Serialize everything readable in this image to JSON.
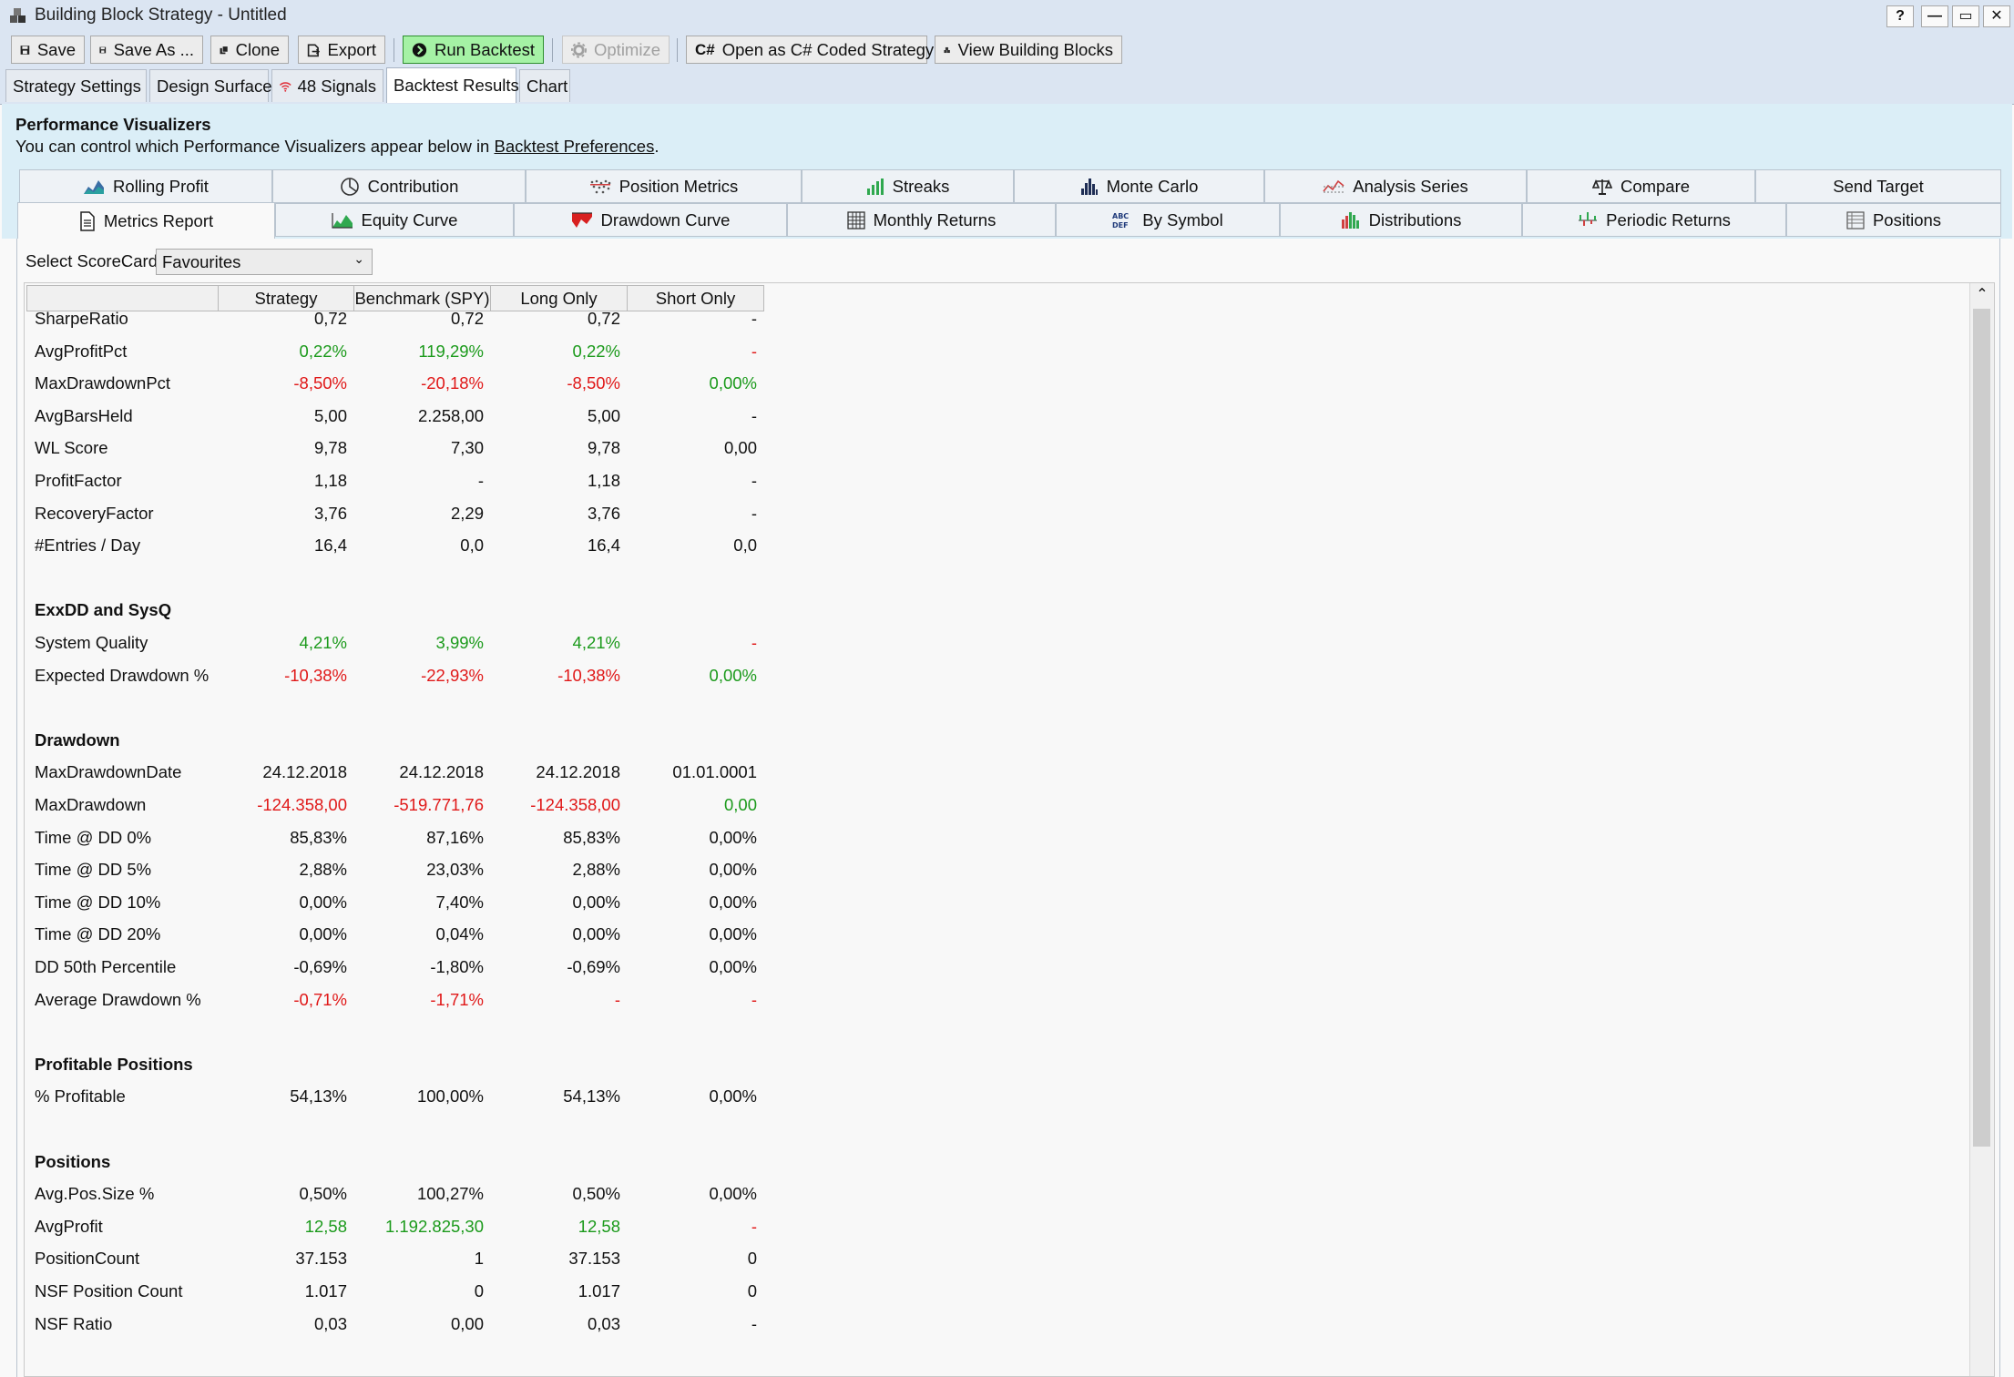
{
  "window": {
    "title": "Building Block Strategy - Untitled",
    "buttons": [
      "?",
      "—",
      "▭",
      "✕"
    ]
  },
  "toolbar": {
    "save": "Save",
    "save_as": "Save As ...",
    "clone": "Clone",
    "export": "Export",
    "run_backtest": "Run Backtest",
    "optimize": "Optimize",
    "open_csharp": "Open as C# Coded Strategy",
    "view_blocks": "View Building Blocks",
    "csharp_glyph": "C#"
  },
  "main_tabs": {
    "strategy_settings": "Strategy Settings",
    "design_surface": "Design Surface",
    "signals": "48 Signals",
    "backtest_results": "Backtest Results",
    "chart": "Chart"
  },
  "info": {
    "heading": "Performance Visualizers",
    "text_before": "You can control which Performance Visualizers appear below in ",
    "link": "Backtest Preferences",
    "text_after": "."
  },
  "visualizer_tabs": {
    "row1": [
      "Rolling Profit",
      "Contribution",
      "Position Metrics",
      "Streaks",
      "Monte Carlo",
      "Analysis Series",
      "Compare",
      "Send Target"
    ],
    "row2": [
      "Metrics Report",
      "Equity Curve",
      "Drawdown Curve",
      "Monthly Returns",
      "By Symbol",
      "Distributions",
      "Periodic Returns",
      "Positions"
    ],
    "active": "Metrics Report",
    "by_symbol_icon_text": [
      "ABC",
      "DEF"
    ]
  },
  "scorecard": {
    "label": "Select ScoreCard:",
    "value": "Favourites"
  },
  "table": {
    "columns": [
      "Strategy",
      "Benchmark (SPY)",
      "Long Only",
      "Short Only"
    ],
    "rows": [
      {
        "type": "row",
        "label": "SharpeRatio",
        "v": [
          "0,72",
          "0,72",
          "0,72",
          "-"
        ],
        "c": [
          "",
          "",
          "",
          ""
        ]
      },
      {
        "type": "row",
        "label": "AvgProfitPct",
        "v": [
          "0,22%",
          "119,29%",
          "0,22%",
          "-"
        ],
        "c": [
          "pos",
          "pos",
          "pos",
          "neg"
        ]
      },
      {
        "type": "row",
        "label": "MaxDrawdownPct",
        "v": [
          "-8,50%",
          "-20,18%",
          "-8,50%",
          "0,00%"
        ],
        "c": [
          "neg",
          "neg",
          "neg",
          "pos"
        ]
      },
      {
        "type": "row",
        "label": "AvgBarsHeld",
        "v": [
          "5,00",
          "2.258,00",
          "5,00",
          "-"
        ],
        "c": [
          "",
          "",
          "",
          ""
        ]
      },
      {
        "type": "row",
        "label": "WL Score",
        "v": [
          "9,78",
          "7,30",
          "9,78",
          "0,00"
        ],
        "c": [
          "",
          "",
          "",
          ""
        ]
      },
      {
        "type": "row",
        "label": "ProfitFactor",
        "v": [
          "1,18",
          "-",
          "1,18",
          "-"
        ],
        "c": [
          "",
          "",
          "",
          ""
        ]
      },
      {
        "type": "row",
        "label": "RecoveryFactor",
        "v": [
          "3,76",
          "2,29",
          "3,76",
          "-"
        ],
        "c": [
          "",
          "",
          "",
          ""
        ]
      },
      {
        "type": "row",
        "label": "#Entries / Day",
        "v": [
          "16,4",
          "0,0",
          "16,4",
          "0,0"
        ],
        "c": [
          "",
          "",
          "",
          ""
        ]
      },
      {
        "type": "blank"
      },
      {
        "type": "section",
        "label": "ExxDD and SysQ"
      },
      {
        "type": "row",
        "label": "System Quality",
        "v": [
          "4,21%",
          "3,99%",
          "4,21%",
          "-"
        ],
        "c": [
          "pos",
          "pos",
          "pos",
          "neg"
        ]
      },
      {
        "type": "row",
        "label": "Expected Drawdown %",
        "v": [
          "-10,38%",
          "-22,93%",
          "-10,38%",
          "0,00%"
        ],
        "c": [
          "neg",
          "neg",
          "neg",
          "pos"
        ]
      },
      {
        "type": "blank"
      },
      {
        "type": "section",
        "label": "Drawdown"
      },
      {
        "type": "row",
        "label": "MaxDrawdownDate",
        "v": [
          "24.12.2018",
          "24.12.2018",
          "24.12.2018",
          "01.01.0001"
        ],
        "c": [
          "",
          "",
          "",
          ""
        ]
      },
      {
        "type": "row",
        "label": "MaxDrawdown",
        "v": [
          "-124.358,00",
          "-519.771,76",
          "-124.358,00",
          "0,00"
        ],
        "c": [
          "neg",
          "neg",
          "neg",
          "pos"
        ]
      },
      {
        "type": "row",
        "label": "Time @ DD 0%",
        "v": [
          "85,83%",
          "87,16%",
          "85,83%",
          "0,00%"
        ],
        "c": [
          "",
          "",
          "",
          ""
        ]
      },
      {
        "type": "row",
        "label": "Time @ DD 5%",
        "v": [
          "2,88%",
          "23,03%",
          "2,88%",
          "0,00%"
        ],
        "c": [
          "",
          "",
          "",
          ""
        ]
      },
      {
        "type": "row",
        "label": "Time @ DD 10%",
        "v": [
          "0,00%",
          "7,40%",
          "0,00%",
          "0,00%"
        ],
        "c": [
          "",
          "",
          "",
          ""
        ]
      },
      {
        "type": "row",
        "label": "Time @ DD 20%",
        "v": [
          "0,00%",
          "0,04%",
          "0,00%",
          "0,00%"
        ],
        "c": [
          "",
          "",
          "",
          ""
        ]
      },
      {
        "type": "row",
        "label": "DD 50th Percentile",
        "v": [
          "-0,69%",
          "-1,80%",
          "-0,69%",
          "0,00%"
        ],
        "c": [
          "",
          "",
          "",
          ""
        ]
      },
      {
        "type": "row",
        "label": "Average Drawdown %",
        "v": [
          "-0,71%",
          "-1,71%",
          "-",
          "-"
        ],
        "c": [
          "neg",
          "neg",
          "neg",
          "neg"
        ]
      },
      {
        "type": "blank"
      },
      {
        "type": "section",
        "label": "Profitable Positions"
      },
      {
        "type": "row",
        "label": "% Profitable",
        "v": [
          "54,13%",
          "100,00%",
          "54,13%",
          "0,00%"
        ],
        "c": [
          "",
          "",
          "",
          ""
        ]
      },
      {
        "type": "blank"
      },
      {
        "type": "section",
        "label": "Positions"
      },
      {
        "type": "row",
        "label": "Avg.Pos.Size %",
        "v": [
          "0,50%",
          "100,27%",
          "0,50%",
          "0,00%"
        ],
        "c": [
          "",
          "",
          "",
          ""
        ]
      },
      {
        "type": "row",
        "label": "AvgProfit",
        "v": [
          "12,58",
          "1.192.825,30",
          "12,58",
          "-"
        ],
        "c": [
          "pos",
          "pos",
          "pos",
          "neg"
        ]
      },
      {
        "type": "row",
        "label": "PositionCount",
        "v": [
          "37.153",
          "1",
          "37.153",
          "0"
        ],
        "c": [
          "",
          "",
          "",
          ""
        ]
      },
      {
        "type": "row",
        "label": "NSF Position Count",
        "v": [
          "1.017",
          "0",
          "1.017",
          "0"
        ],
        "c": [
          "",
          "",
          "",
          ""
        ]
      },
      {
        "type": "row",
        "label": "NSF Ratio",
        "v": [
          "0,03",
          "0,00",
          "0,03",
          "-"
        ],
        "c": [
          "",
          "",
          "",
          ""
        ]
      }
    ]
  },
  "colors": {
    "positive": "#1b9a1b",
    "negative": "#e01818",
    "run_button": "#a5f2a5",
    "panel": "#dbeef7",
    "titlebar": "#dbe5f2"
  }
}
